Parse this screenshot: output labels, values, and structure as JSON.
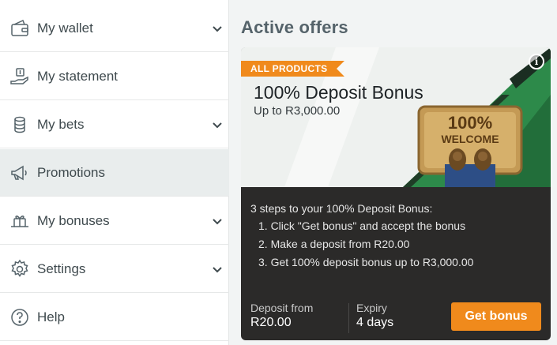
{
  "sidebar": {
    "items": [
      {
        "label": "My wallet",
        "icon": "wallet-icon",
        "has_chevron": true
      },
      {
        "label": "My statement",
        "icon": "statement-icon",
        "has_chevron": false
      },
      {
        "label": "My bets",
        "icon": "bets-icon",
        "has_chevron": true
      },
      {
        "label": "Promotions",
        "icon": "megaphone-icon",
        "has_chevron": false,
        "active": true
      },
      {
        "label": "My bonuses",
        "icon": "bonuses-icon",
        "has_chevron": true
      },
      {
        "label": "Settings",
        "icon": "gear-icon",
        "has_chevron": true
      },
      {
        "label": "Help",
        "icon": "help-icon",
        "has_chevron": false
      }
    ]
  },
  "main": {
    "title": "Active offers",
    "offer": {
      "tag": "ALL PRODUCTS",
      "title": "100% Deposit Bonus",
      "subtitle": "Up to R3,000.00",
      "steps_title": "3 steps to your 100% Deposit Bonus:",
      "steps": [
        "1. Click \"Get bonus\" and accept the bonus",
        "2. Make a deposit from R20.00",
        "3. Get 100% deposit bonus up to R3,000.00"
      ],
      "deposit_label": "Deposit from",
      "deposit_value": "R20.00",
      "expiry_label": "Expiry",
      "expiry_value": "4 days",
      "button_label": "Get bonus",
      "mat_text_top": "100%",
      "mat_text_bottom": "WELCOME"
    }
  },
  "colors": {
    "accent": "#f08a1c",
    "card_dark": "#2b2a29",
    "banner_green": "#2d8a4a",
    "text_muted": "#55636a"
  }
}
